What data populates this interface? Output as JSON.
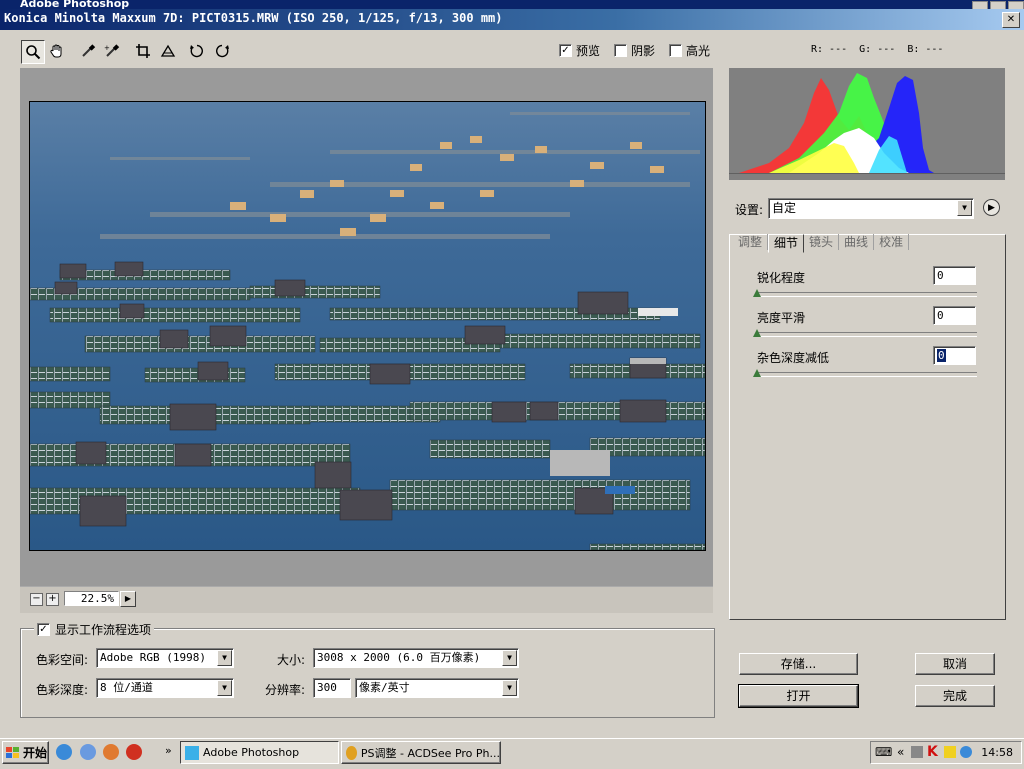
{
  "app_window": {
    "title": "Adobe Photoshop"
  },
  "dialog": {
    "title": "Konica Minolta Maxxum 7D:  PICT0315.MRW  (ISO 250, 1/125, f/13, 300 mm)"
  },
  "tools": [
    {
      "name": "zoom-tool",
      "icon": "magnifier-icon"
    },
    {
      "name": "hand-tool",
      "icon": "hand-icon"
    },
    {
      "name": "white-balance-tool",
      "icon": "eyedropper-icon"
    },
    {
      "name": "color-sampler-tool",
      "icon": "color-sampler-icon"
    },
    {
      "name": "crop-tool",
      "icon": "crop-icon"
    },
    {
      "name": "straighten-tool",
      "icon": "straighten-icon"
    },
    {
      "name": "rotate-left-tool",
      "icon": "rotate-ccw-icon"
    },
    {
      "name": "rotate-right-tool",
      "icon": "rotate-cw-icon"
    }
  ],
  "preview_options": {
    "preview": {
      "label": "预览",
      "checked": true
    },
    "shadows": {
      "label": "阴影",
      "checked": false
    },
    "highlights": {
      "label": "高光",
      "checked": false
    }
  },
  "rgb_readout": "R: ---  G: ---  B: ---",
  "zoom": {
    "minus": "−",
    "plus": "+",
    "value": "22.5%"
  },
  "workflow": {
    "toggle_label": "显示工作流程选项",
    "toggle_checked": true,
    "color_space_label": "色彩空间:",
    "color_space_value": "Adobe RGB (1998)",
    "bit_depth_label": "色彩深度:",
    "bit_depth_value": "8 位/通道",
    "size_label": "大小:",
    "size_value": "3008 x 2000  (6.0 百万像素)",
    "resolution_label": "分辨率:",
    "resolution_value": "300",
    "resolution_unit": "像素/英寸"
  },
  "settings": {
    "label": "设置:",
    "value": "自定"
  },
  "tabs": [
    {
      "label": "调整",
      "active": false
    },
    {
      "label": "细节",
      "active": true
    },
    {
      "label": "镜头",
      "active": false
    },
    {
      "label": "曲线",
      "active": false
    },
    {
      "label": "校准",
      "active": false
    }
  ],
  "detail": {
    "sharpness": {
      "label": "锐化程度",
      "value": "0"
    },
    "luminance_smoothing": {
      "label": "亮度平滑",
      "value": "0"
    },
    "color_noise_reduction": {
      "label": "杂色深度减低",
      "value": "0"
    }
  },
  "buttons": {
    "save": "存储...",
    "open": "打开",
    "cancel": "取消",
    "done": "完成"
  },
  "taskbar": {
    "start_label": "开始",
    "tasks": [
      {
        "label": "Adobe Photoshop",
        "active": true
      },
      {
        "label": "PS调整 - ACDSee Pro Ph...",
        "active": false
      }
    ],
    "clock": "14:58"
  },
  "colors": {
    "titlebar": "#0a246a",
    "face": "#d4d0c8",
    "water": "#2f5a8a"
  }
}
